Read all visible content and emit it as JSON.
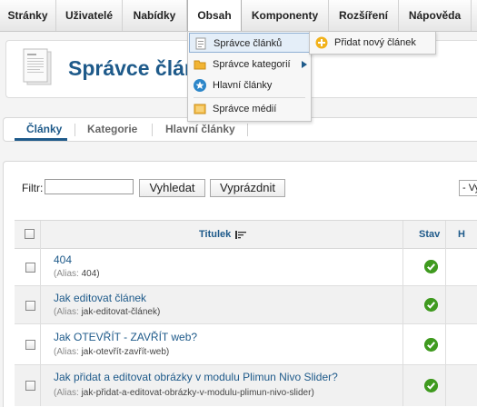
{
  "menubar": {
    "items": [
      {
        "label": "Stránky"
      },
      {
        "label": "Uživatelé"
      },
      {
        "label": "Nabídky"
      },
      {
        "label": "Obsah"
      },
      {
        "label": "Komponenty"
      },
      {
        "label": "Rozšíření"
      },
      {
        "label": "Nápověda"
      }
    ]
  },
  "obsah_menu": {
    "items": [
      {
        "label": "Správce článků",
        "icon": "article-icon"
      },
      {
        "label": "Správce kategorií",
        "icon": "folder-icon"
      },
      {
        "label": "Hlavní články",
        "icon": "star-icon"
      },
      {
        "label": "Správce médií",
        "icon": "media-icon"
      }
    ],
    "submenu": {
      "label": "Přidat nový článek",
      "icon": "add-icon"
    }
  },
  "header": {
    "title": "Správce člán"
  },
  "subtabs": [
    {
      "label": "Články"
    },
    {
      "label": "Kategorie"
    },
    {
      "label": "Hlavní články"
    }
  ],
  "filter": {
    "label": "Filtr:",
    "value": "",
    "search_label": "Vyhledat",
    "clear_label": "Vyprázdnit",
    "select_value": "- Vy"
  },
  "table": {
    "columns": {
      "title": "Titulek",
      "status": "Stav",
      "next": "H"
    },
    "rows": [
      {
        "title": "404",
        "alias_label": "(Alias:",
        "alias": "404)"
      },
      {
        "title": "Jak editovat článek",
        "alias_label": "(Alias:",
        "alias": "jak-editovat-článek)"
      },
      {
        "title": "Jak OTEVŘÍT - ZAVŘÍT web?",
        "alias_label": "(Alias:",
        "alias": "jak-otevřít-zavřít-web)"
      },
      {
        "title": "Jak přidat a editovat obrázky v modulu Plimun Nivo Slider?",
        "alias_label": "(Alias:",
        "alias": "jak-přidat-a-editovat-obrázky-v-modulu-plimun-nivo-slider)"
      }
    ]
  },
  "colors": {
    "accent": "#1e5a8a",
    "status_published": "#3f9a1f"
  }
}
